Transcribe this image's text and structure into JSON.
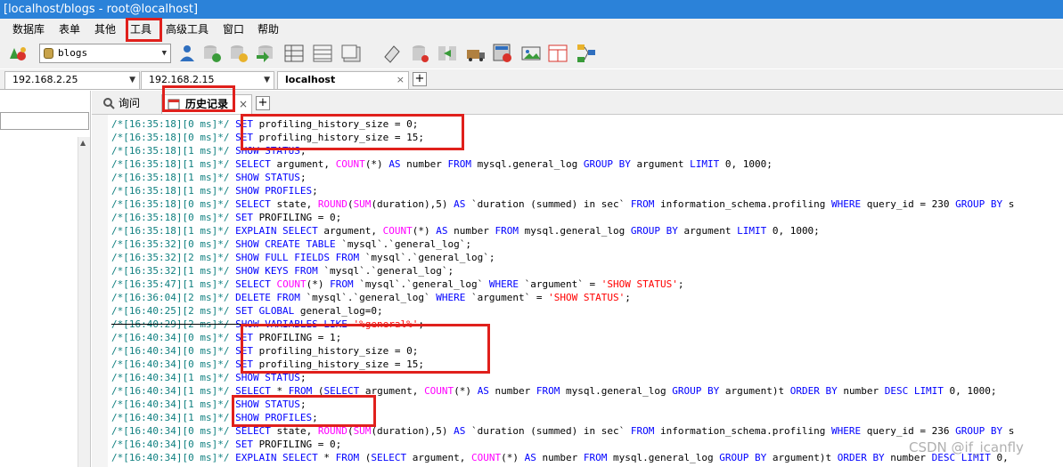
{
  "window": {
    "title": "[localhost/blogs - root@localhost]"
  },
  "menu": {
    "items": [
      "数据库",
      "表单",
      "其他",
      "工具",
      "高级工具",
      "窗口",
      "帮助"
    ]
  },
  "toolbar": {
    "database_select": "blogs",
    "icons": [
      "connect-icon",
      "db-icon",
      "db-select",
      "user-icon",
      "backup-icon",
      "restore-icon",
      "import-icon",
      "table-icon",
      "grid-icon",
      "grid-icon",
      "schema-icon",
      "sync-icon",
      "data-sync-icon",
      "migrate-icon",
      "query-icon",
      "image-icon",
      "report-icon",
      "diagram-icon"
    ]
  },
  "connection_tabs": {
    "tabs": [
      {
        "label": "192.168.2.25"
      },
      {
        "label": "192.168.2.15"
      },
      {
        "label": "localhost",
        "close": "×"
      }
    ],
    "add": "+"
  },
  "query_tabs": {
    "tabs": [
      {
        "label": "询问"
      },
      {
        "label": "历史记录",
        "close": "×"
      }
    ],
    "add": "+"
  },
  "history": {
    "lines": [
      {
        "ts": "/*[16:35:18][0 ms]*/",
        "segs": [
          [
            "kw",
            "SET"
          ],
          [
            "p",
            " profiling_history_size = 0;"
          ]
        ]
      },
      {
        "ts": "/*[16:35:18][0 ms]*/",
        "segs": [
          [
            "kw",
            "SET"
          ],
          [
            "p",
            " profiling_history_size = 15;"
          ]
        ]
      },
      {
        "ts": "/*[16:35:18][1 ms]*/",
        "segs": [
          [
            "kw",
            "SHOW STATUS"
          ],
          [
            "p",
            ";"
          ]
        ]
      },
      {
        "ts": "/*[16:35:18][1 ms]*/",
        "segs": [
          [
            "kw",
            "SELECT"
          ],
          [
            "p",
            " argument, "
          ],
          [
            "fn",
            "COUNT"
          ],
          [
            "p",
            "(*) "
          ],
          [
            "kw",
            "AS"
          ],
          [
            "p",
            " number "
          ],
          [
            "kw",
            "FROM"
          ],
          [
            "p",
            " mysql.general_log "
          ],
          [
            "kw",
            "GROUP BY"
          ],
          [
            "p",
            " argument "
          ],
          [
            "kw",
            "LIMIT"
          ],
          [
            "p",
            " 0, 1000;"
          ]
        ]
      },
      {
        "ts": "/*[16:35:18][1 ms]*/",
        "segs": [
          [
            "kw",
            "SHOW STATUS"
          ],
          [
            "p",
            ";"
          ]
        ]
      },
      {
        "ts": "/*[16:35:18][1 ms]*/",
        "segs": [
          [
            "kw",
            "SHOW PROFILES"
          ],
          [
            "p",
            ";"
          ]
        ]
      },
      {
        "ts": "/*[16:35:18][0 ms]*/",
        "segs": [
          [
            "kw",
            "SELECT"
          ],
          [
            "p",
            " state, "
          ],
          [
            "fn",
            "ROUND"
          ],
          [
            "p",
            "("
          ],
          [
            "fn",
            "SUM"
          ],
          [
            "p",
            "(duration),5) "
          ],
          [
            "kw",
            "AS"
          ],
          [
            "p",
            " `duration (summed) in sec` "
          ],
          [
            "kw",
            "FROM"
          ],
          [
            "p",
            " information_schema.profiling "
          ],
          [
            "kw",
            "WHERE"
          ],
          [
            "p",
            " query_id = 230 "
          ],
          [
            "kw",
            "GROUP BY"
          ],
          [
            "p",
            " s"
          ]
        ]
      },
      {
        "ts": "/*[16:35:18][0 ms]*/",
        "segs": [
          [
            "kw",
            "SET"
          ],
          [
            "p",
            " PROFILING = 0;"
          ]
        ]
      },
      {
        "ts": "/*[16:35:18][1 ms]*/",
        "segs": [
          [
            "kw",
            "EXPLAIN SELECT"
          ],
          [
            "p",
            " argument, "
          ],
          [
            "fn",
            "COUNT"
          ],
          [
            "p",
            "(*) "
          ],
          [
            "kw",
            "AS"
          ],
          [
            "p",
            " number "
          ],
          [
            "kw",
            "FROM"
          ],
          [
            "p",
            " mysql.general_log "
          ],
          [
            "kw",
            "GROUP BY"
          ],
          [
            "p",
            " argument "
          ],
          [
            "kw",
            "LIMIT"
          ],
          [
            "p",
            " 0, 1000;"
          ]
        ]
      },
      {
        "ts": "/*[16:35:32][0 ms]*/",
        "segs": [
          [
            "kw",
            "SHOW CREATE TABLE"
          ],
          [
            "p",
            " `mysql`.`general_log`;"
          ]
        ]
      },
      {
        "ts": "/*[16:35:32][2 ms]*/",
        "segs": [
          [
            "kw",
            "SHOW FULL FIELDS FROM"
          ],
          [
            "p",
            " `mysql`.`general_log`;"
          ]
        ]
      },
      {
        "ts": "/*[16:35:32][1 ms]*/",
        "segs": [
          [
            "kw",
            "SHOW KEYS FROM"
          ],
          [
            "p",
            " `mysql`.`general_log`;"
          ]
        ]
      },
      {
        "ts": "/*[16:35:47][1 ms]*/",
        "segs": [
          [
            "kw",
            "SELECT"
          ],
          [
            "p",
            " "
          ],
          [
            "fn",
            "COUNT"
          ],
          [
            "p",
            "(*) "
          ],
          [
            "kw",
            "FROM"
          ],
          [
            "p",
            " `mysql`.`general_log` "
          ],
          [
            "kw",
            "WHERE"
          ],
          [
            "p",
            " `argument` = "
          ],
          [
            "str",
            "'SHOW STATUS'"
          ],
          [
            "p",
            ";"
          ]
        ]
      },
      {
        "ts": "/*[16:36:04][2 ms]*/",
        "segs": [
          [
            "kw",
            "DELETE FROM"
          ],
          [
            "p",
            " `mysql`.`general_log` "
          ],
          [
            "kw",
            "WHERE"
          ],
          [
            "p",
            " `argument` = "
          ],
          [
            "str",
            "'SHOW STATUS'"
          ],
          [
            "p",
            ";"
          ]
        ]
      },
      {
        "ts": "/*[16:40:25][2 ms]*/",
        "segs": [
          [
            "kw",
            "SET GLOBAL"
          ],
          [
            "p",
            " general_log=0;"
          ]
        ]
      },
      {
        "ts": "/*[16:40:29][2 ms]*/",
        "segs": [
          [
            "kw",
            "SHOW VARIABLES LIKE"
          ],
          [
            "p",
            " "
          ],
          [
            "str",
            "'%general%'"
          ],
          [
            "p",
            ";"
          ]
        ],
        "strike": true
      },
      {
        "ts": "/*[16:40:34][0 ms]*/",
        "segs": [
          [
            "kw",
            "SET"
          ],
          [
            "p",
            " PROFILING = 1;"
          ]
        ]
      },
      {
        "ts": "/*[16:40:34][0 ms]*/",
        "segs": [
          [
            "kw",
            "SET"
          ],
          [
            "p",
            " profiling_history_size = 0;"
          ]
        ]
      },
      {
        "ts": "/*[16:40:34][0 ms]*/",
        "segs": [
          [
            "kw",
            "SET"
          ],
          [
            "p",
            " profiling_history_size = 15;"
          ]
        ]
      },
      {
        "ts": "/*[16:40:34][1 ms]*/",
        "segs": [
          [
            "kw",
            "SHOW STATUS"
          ],
          [
            "p",
            ";"
          ]
        ]
      },
      {
        "ts": "/*[16:40:34][1 ms]*/",
        "segs": [
          [
            "kw",
            "SELECT"
          ],
          [
            "p",
            " * "
          ],
          [
            "kw",
            "FROM"
          ],
          [
            "p",
            " ("
          ],
          [
            "kw",
            "SELECT"
          ],
          [
            "p",
            " argument, "
          ],
          [
            "fn",
            "COUNT"
          ],
          [
            "p",
            "(*) "
          ],
          [
            "kw",
            "AS"
          ],
          [
            "p",
            " number "
          ],
          [
            "kw",
            "FROM"
          ],
          [
            "p",
            " mysql.general_log "
          ],
          [
            "kw",
            "GROUP BY"
          ],
          [
            "p",
            " argument)t "
          ],
          [
            "kw",
            "ORDER BY"
          ],
          [
            "p",
            " number "
          ],
          [
            "kw",
            "DESC LIMIT"
          ],
          [
            "p",
            " 0, 1000;"
          ]
        ]
      },
      {
        "ts": "/*[16:40:34][1 ms]*/",
        "segs": [
          [
            "kw",
            "SHOW STATUS"
          ],
          [
            "p",
            ";"
          ]
        ]
      },
      {
        "ts": "/*[16:40:34][1 ms]*/",
        "segs": [
          [
            "kw",
            "SHOW PROFILES"
          ],
          [
            "p",
            ";"
          ]
        ]
      },
      {
        "ts": "/*[16:40:34][0 ms]*/",
        "segs": [
          [
            "kw",
            "SELECT"
          ],
          [
            "p",
            " state, "
          ],
          [
            "fn",
            "ROUND"
          ],
          [
            "p",
            "("
          ],
          [
            "fn",
            "SUM"
          ],
          [
            "p",
            "(duration),5) "
          ],
          [
            "kw",
            "AS"
          ],
          [
            "p",
            " `duration (summed) in sec` "
          ],
          [
            "kw",
            "FROM"
          ],
          [
            "p",
            " information_schema.profiling "
          ],
          [
            "kw",
            "WHERE"
          ],
          [
            "p",
            " query_id = 236 "
          ],
          [
            "kw",
            "GROUP BY"
          ],
          [
            "p",
            " s"
          ]
        ]
      },
      {
        "ts": "/*[16:40:34][0 ms]*/",
        "segs": [
          [
            "kw",
            "SET"
          ],
          [
            "p",
            " PROFILING = 0;"
          ]
        ]
      },
      {
        "ts": "/*[16:40:34][0 ms]*/",
        "segs": [
          [
            "kw",
            "EXPLAIN SELECT"
          ],
          [
            "p",
            " * "
          ],
          [
            "kw",
            "FROM"
          ],
          [
            "p",
            " ("
          ],
          [
            "kw",
            "SELECT"
          ],
          [
            "p",
            " argument, "
          ],
          [
            "fn",
            "COUNT"
          ],
          [
            "p",
            "(*) "
          ],
          [
            "kw",
            "AS"
          ],
          [
            "p",
            " number "
          ],
          [
            "kw",
            "FROM"
          ],
          [
            "p",
            " mysql.general_log "
          ],
          [
            "kw",
            "GROUP BY"
          ],
          [
            "p",
            " argument)t "
          ],
          [
            "kw",
            "ORDER BY"
          ],
          [
            "p",
            " number "
          ],
          [
            "kw",
            "DESC LIMIT"
          ],
          [
            "p",
            " 0,"
          ]
        ]
      }
    ]
  },
  "watermark": "CSDN @if_icanfly",
  "colors": {
    "annotation": "#e0201c",
    "titlebar": "#2b82d9",
    "timestamp": "#108080",
    "keyword": "#0000ff",
    "function": "#ff00ff",
    "string": "#ff0000"
  }
}
